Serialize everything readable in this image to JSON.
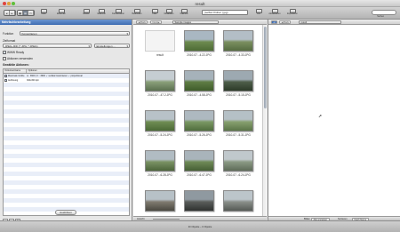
{
  "window": {
    "title": "result"
  },
  "toolbar": {
    "buttons": [
      "Datei",
      "Stapel",
      "Erkennen",
      "Effekte",
      "Gedruckt",
      "Farbkorrektur",
      "Bearbeiten",
      "Filter",
      "Metadaten",
      "Stapel",
      "Diashow",
      "Info",
      "Aktualisieren",
      "Exportieren"
    ],
    "folder": "(selbst Ordner | jpg)",
    "search_label": "Suchen"
  },
  "left_panel": {
    "header": "Mehrfachbearbeitung",
    "funktion_label": "Funktion",
    "funktion_value": "Konvertieren",
    "zielformat_label": "Zielformat",
    "zielformat_value": "JPEG-JFIF (*.JPG; *.JPEG)",
    "einstellungen": "Einstellungen ...",
    "checkbox_1": "WWW Ready",
    "checkbox_2": "Aktionen verwenden",
    "gewaehlte_label": "Gewählte Aktionen:",
    "table_headers": [
      "Dokumentname",
      "Optionen"
    ],
    "table_rows": [
      {
        "name": "Maximale Größe",
        "options": "w : 3600 | C : 3600 ✓ vertikal maximieren ✓ proportional"
      },
      {
        "name": "Auflösung",
        "options": "300x300 dpi"
      }
    ],
    "mini_buttons": [
      "+",
      "−",
      "⚙"
    ],
    "run_button": "Ausführen"
  },
  "middle_pane": {
    "back": "◀ Back",
    "forward": "Next ▶",
    "path": "Sample images",
    "items": [
      {
        "name": "result"
      },
      {
        "name": "2010-07...4.22.JPG"
      },
      {
        "name": "2010-07...4.33.JPG"
      },
      {
        "name": "2010-07...47.2.JPG"
      },
      {
        "name": "2010-07...4.58.JPG"
      },
      {
        "name": "2010-07...5.15.JPG"
      },
      {
        "name": "2010-07...5.24.JPG"
      },
      {
        "name": "2010-07...5.26.JPG"
      },
      {
        "name": "2010-07...5.31.JPG"
      },
      {
        "name": "2010-07...6.28.JPG"
      },
      {
        "name": "2010-07...6.47.JPG"
      },
      {
        "name": "2010-07...6.24.JPG"
      },
      {
        "name": ""
      },
      {
        "name": ""
      },
      {
        "name": ""
      }
    ],
    "footer_left": "Ansicht"
  },
  "right_pane": {
    "back": "◀ Back",
    "path": "result",
    "footer_items": [
      "Bilder",
      "Alle anzeigen",
      "Sortieren",
      "Nach Name"
    ]
  },
  "status": {
    "text": "30 Objekte – 0 Objekte"
  },
  "colors": {
    "selection": "#3e6db3",
    "accent": "#5a6472"
  }
}
